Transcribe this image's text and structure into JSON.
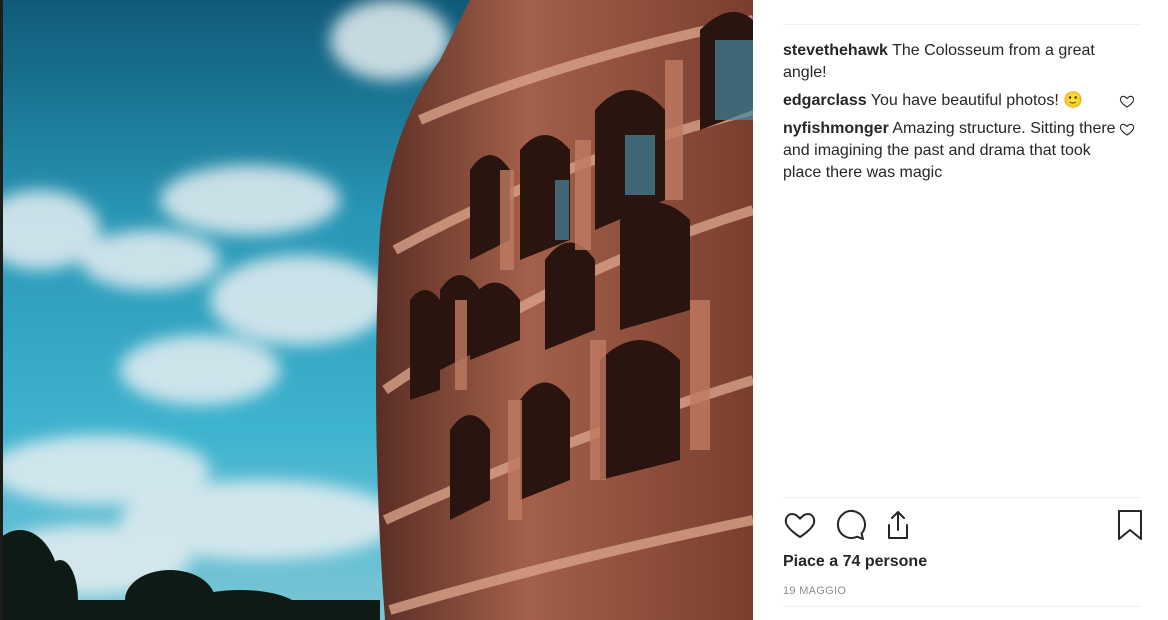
{
  "comments": [
    {
      "user": "stevethehawk",
      "text": "The Colosseum from a great angle!",
      "likeable": false
    },
    {
      "user": "edgarclass",
      "text": "You have beautiful photos! 🙂",
      "likeable": true
    },
    {
      "user": "nyfishmonger",
      "text": "Amazing structure. Sitting there and imagining the past and drama that took place there was magic",
      "likeable": true
    }
  ],
  "actions": {
    "like": "heart-icon",
    "comment": "comment-icon",
    "share": "share-icon",
    "save": "bookmark-icon"
  },
  "likes_text": "Piace a 74 persone",
  "date_text": "19 MAGGIO",
  "colors": {
    "sky": "#2aa3c0",
    "stone": "#8a4a36",
    "text": "#262626",
    "muted": "#8e8e8e"
  }
}
